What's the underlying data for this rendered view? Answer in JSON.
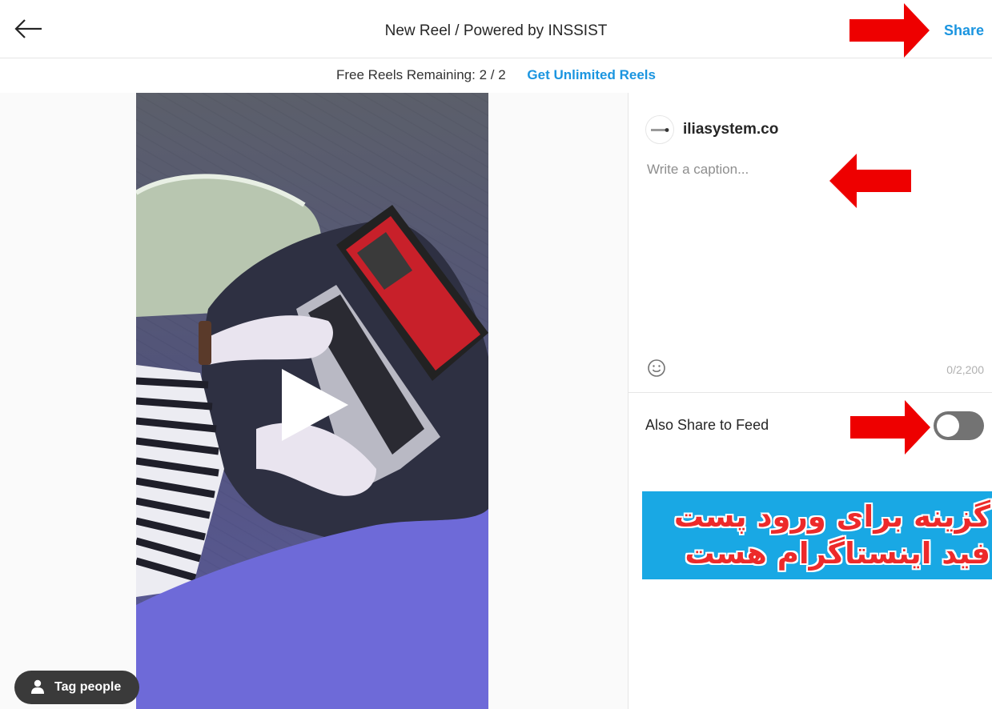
{
  "header": {
    "title": "New Reel / Powered by INSSIST",
    "share_label": "Share"
  },
  "subbar": {
    "remaining": "Free Reels Remaining: 2 / 2",
    "unlimited_link": "Get Unlimited Reels"
  },
  "media": {
    "tag_people_label": "Tag people"
  },
  "post": {
    "username": "iliasystem.co",
    "caption_placeholder": "Write a caption...",
    "caption_value": "",
    "char_count": "0/2,200",
    "share_to_feed_label": "Also Share to Feed",
    "share_to_feed_on": false
  },
  "annotation": {
    "line1": "گزینه برای ورود پست",
    "line2": "فید اینستاگرام هست"
  },
  "colors": {
    "accent": "#1b95e0",
    "arrow": "#ee0000",
    "annotation_bg": "#19a8e4",
    "toggle_off": "#737373"
  }
}
